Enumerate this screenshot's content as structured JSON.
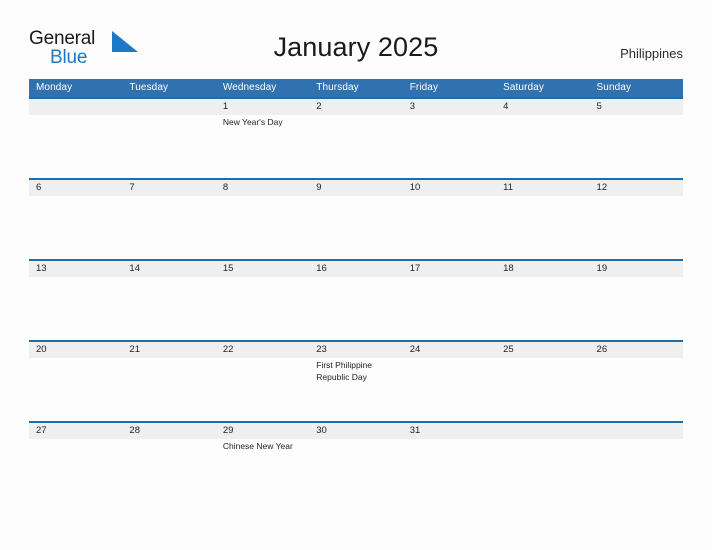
{
  "brand": {
    "name_part1": "General",
    "name_part2": "Blue",
    "triangle_icon": "triangle-right-icon",
    "accent_color": "#1b79c8"
  },
  "header": {
    "title": "January 2025",
    "region": "Philippines"
  },
  "theme": {
    "header_blue": "#3071b0",
    "row_rule_blue": "#1f6cab",
    "band_gray": "#efefef",
    "page_background": "#fdfdfd",
    "text_color": "#232323"
  },
  "calendar": {
    "month": "January",
    "year": "2025",
    "weekday_headers": [
      "Monday",
      "Tuesday",
      "Wednesday",
      "Thursday",
      "Friday",
      "Saturday",
      "Sunday"
    ],
    "weeks": [
      [
        {
          "date": "",
          "events": ""
        },
        {
          "date": "",
          "events": ""
        },
        {
          "date": "1",
          "events": "New Year's Day"
        },
        {
          "date": "2",
          "events": ""
        },
        {
          "date": "3",
          "events": ""
        },
        {
          "date": "4",
          "events": ""
        },
        {
          "date": "5",
          "events": ""
        }
      ],
      [
        {
          "date": "6",
          "events": ""
        },
        {
          "date": "7",
          "events": ""
        },
        {
          "date": "8",
          "events": ""
        },
        {
          "date": "9",
          "events": ""
        },
        {
          "date": "10",
          "events": ""
        },
        {
          "date": "11",
          "events": ""
        },
        {
          "date": "12",
          "events": ""
        }
      ],
      [
        {
          "date": "13",
          "events": ""
        },
        {
          "date": "14",
          "events": ""
        },
        {
          "date": "15",
          "events": ""
        },
        {
          "date": "16",
          "events": ""
        },
        {
          "date": "17",
          "events": ""
        },
        {
          "date": "18",
          "events": ""
        },
        {
          "date": "19",
          "events": ""
        }
      ],
      [
        {
          "date": "20",
          "events": ""
        },
        {
          "date": "21",
          "events": ""
        },
        {
          "date": "22",
          "events": ""
        },
        {
          "date": "23",
          "events": "First Philippine Republic Day"
        },
        {
          "date": "24",
          "events": ""
        },
        {
          "date": "25",
          "events": ""
        },
        {
          "date": "26",
          "events": ""
        }
      ],
      [
        {
          "date": "27",
          "events": ""
        },
        {
          "date": "28",
          "events": ""
        },
        {
          "date": "29",
          "events": "Chinese New Year"
        },
        {
          "date": "30",
          "events": ""
        },
        {
          "date": "31",
          "events": ""
        },
        {
          "date": "",
          "events": ""
        },
        {
          "date": "",
          "events": ""
        }
      ]
    ]
  }
}
